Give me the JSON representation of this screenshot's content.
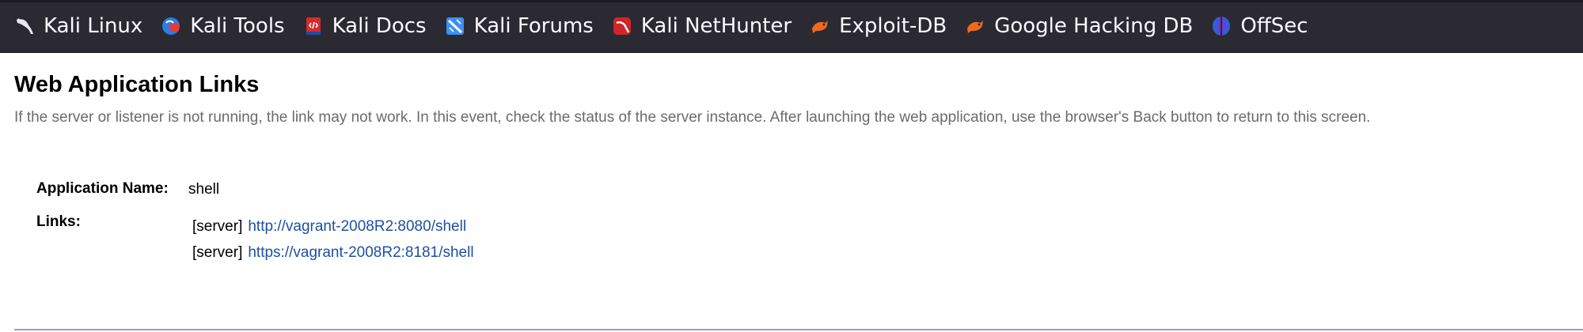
{
  "bookmarks": [
    {
      "label": "Kali Linux",
      "icon": "kali-dragon-icon"
    },
    {
      "label": "Kali Tools",
      "icon": "kali-tools-icon"
    },
    {
      "label": "Kali Docs",
      "icon": "kali-docs-icon"
    },
    {
      "label": "Kali Forums",
      "icon": "kali-forums-icon"
    },
    {
      "label": "Kali NetHunter",
      "icon": "kali-nethunter-icon"
    },
    {
      "label": "Exploit-DB",
      "icon": "exploit-db-icon"
    },
    {
      "label": "Google Hacking DB",
      "icon": "google-hacking-db-icon"
    },
    {
      "label": "OffSec",
      "icon": "offsec-icon"
    }
  ],
  "page": {
    "title": "Web Application Links",
    "instructions": "If the server or listener is not running, the link may not work. In this event, check the status of the server instance. After launching the web application, use the browser's Back button to return to this screen."
  },
  "app": {
    "name_label": "Application Name:",
    "name_value": "shell",
    "links_label": "Links:",
    "links": [
      {
        "tag": "[server]",
        "url": "http://vagrant-2008R2:8080/shell"
      },
      {
        "tag": "[server]",
        "url": "https://vagrant-2008R2:8181/shell"
      }
    ]
  },
  "colors": {
    "toolbar_bg": "#2b2a33",
    "toolbar_text": "#fbfbfe",
    "link": "#1e4fa3",
    "muted_text": "#6b6b6b",
    "rule": "#93a4c2"
  }
}
